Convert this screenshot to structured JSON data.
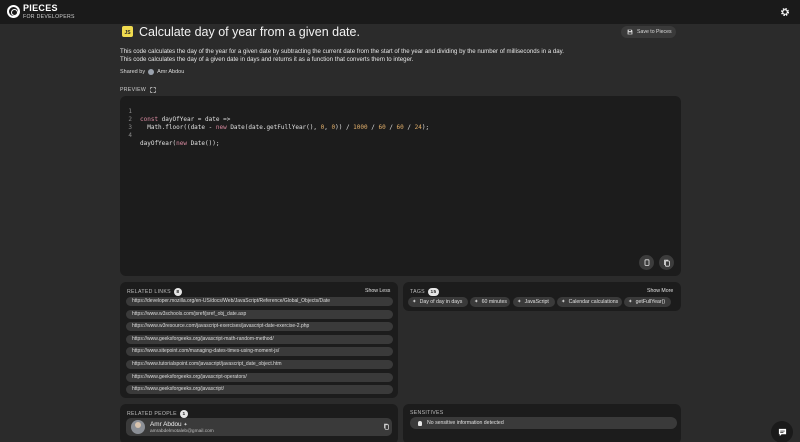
{
  "app": {
    "brand_name": "PIECES",
    "brand_sub": "FOR DEVELOPERS"
  },
  "snippet": {
    "language_badge": "JS",
    "title": "Calculate day of year from a given date.",
    "save_label": "Save to Pieces",
    "description_1": "This code calculates the day of the year for a given date by subtracting the current date from the start of the year and dividing by the number of milliseconds in a day.",
    "description_2": "This code calculates the day of a given date in days and returns it as a function that converts them to integer.",
    "shared_by_label": "Shared by",
    "shared_by_name": "Amr Abdou"
  },
  "preview": {
    "label": "PREVIEW",
    "line_numbers": [
      "1",
      "2",
      "3",
      "4"
    ]
  },
  "links": {
    "label": "RELATED LINKS",
    "count": "8",
    "action": "Show Less",
    "items": [
      "https://developer.mozilla.org/en-US/docs/Web/JavaScript/Reference/Global_Objects/Date",
      "https://www.w3schools.com/jsref/jsref_obj_date.asp",
      "https://www.w3resource.com/javascript-exercises/javascript-date-exercise-2.php",
      "https://www.geeksforgeeks.org/javascript-math-random-method/",
      "https://www.sitepoint.com/managing-dates-times-using-moment-js/",
      "https://www.tutorialspoint.com/javascript/javascript_date_object.htm",
      "https://www.geeksforgeeks.org/javascript-operators/",
      "https://www.geeksforgeeks.org/javascript/"
    ]
  },
  "tags": {
    "label": "TAGS",
    "count": "15",
    "action": "Show More",
    "items": [
      "Day of day in days",
      "60 minutes",
      "JavaScript",
      "Calendar calculations",
      "getFullYear()"
    ]
  },
  "people": {
    "label": "RELATED PEOPLE",
    "count": "1",
    "name": "Amr Abdou",
    "email": "amrabdelmotaleb@gmail.com"
  },
  "sensitives": {
    "label": "SENSITIVES",
    "status": "No sensitive information detected"
  },
  "colors": {
    "background": "#2b2b2b",
    "panel": "#1c1c1c",
    "pill": "#3a3a3a",
    "js_badge": "#f0db4f"
  }
}
